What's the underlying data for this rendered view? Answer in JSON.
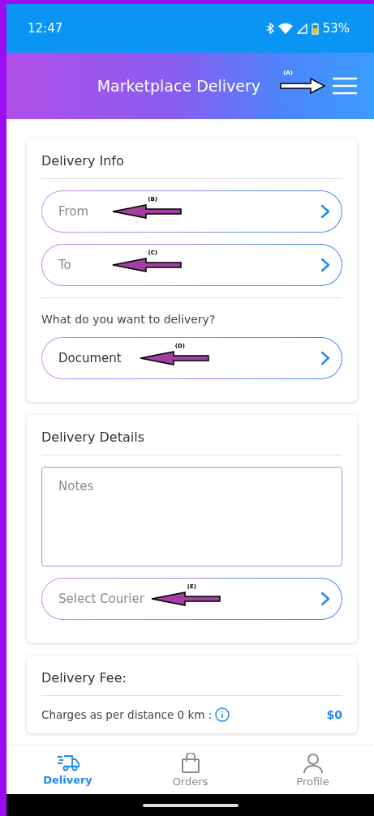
{
  "status_bar": {
    "time": "12:47",
    "battery": "53%"
  },
  "header": {
    "title": "Marketplace Delivery",
    "annotation": "(A)"
  },
  "delivery_info": {
    "title": "Delivery Info",
    "fields": [
      {
        "placeholder": "From",
        "annotation": "(B)"
      },
      {
        "placeholder": "To",
        "annotation": "(C)"
      }
    ],
    "question": "What do you want to delivery?",
    "item": {
      "value": "Document",
      "annotation": "(D)"
    }
  },
  "delivery_details": {
    "title": "Delivery Details",
    "notes": {
      "placeholder": "Notes"
    },
    "courier": {
      "placeholder": "Select Courier",
      "annotation": "(E)"
    }
  },
  "delivery_fee": {
    "title": "Delivery Fee:",
    "rows": [
      {
        "label": "Charges as per distance 0 km :",
        "value": "$0"
      }
    ]
  },
  "nav": [
    {
      "label": "Delivery",
      "selected": true
    },
    {
      "label": "Orders",
      "selected": false
    },
    {
      "label": "Profile",
      "selected": false
    }
  ]
}
